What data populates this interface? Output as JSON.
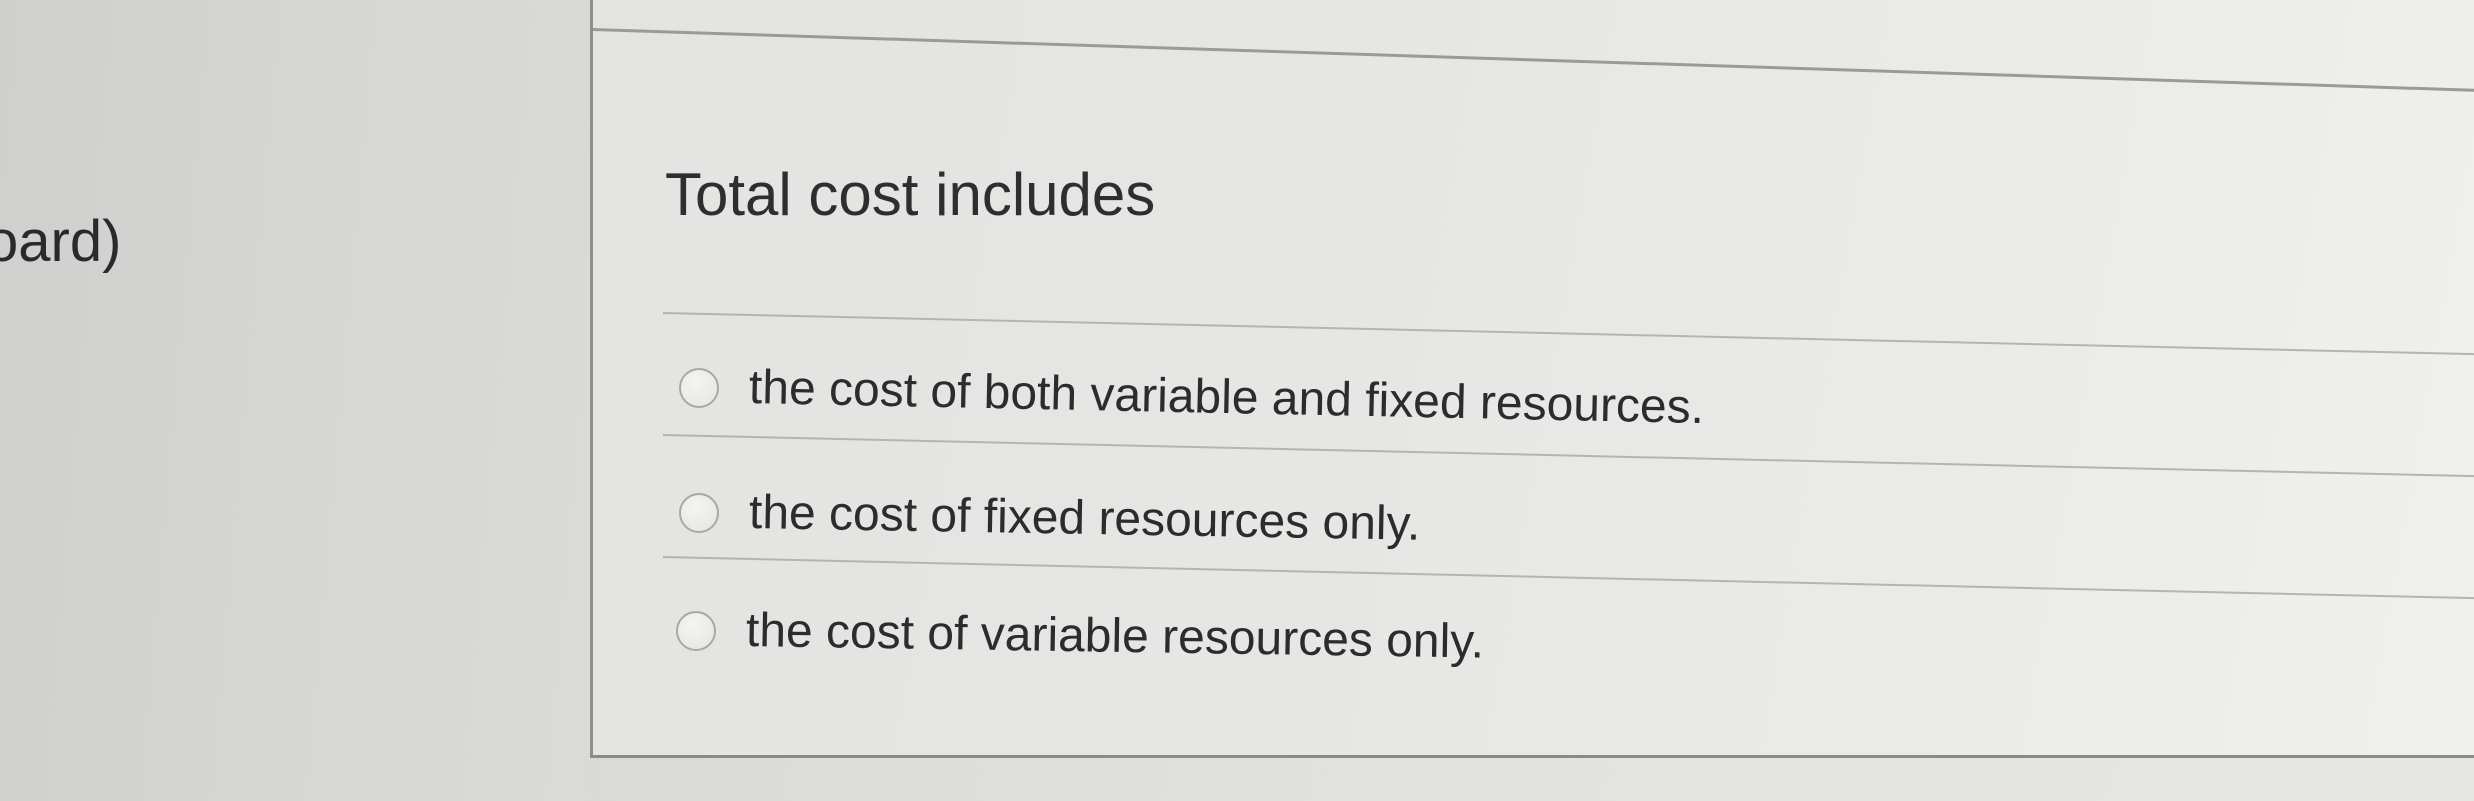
{
  "sidebar": {
    "partial_label": "oard)"
  },
  "question": {
    "prompt": "Total cost includes",
    "options": [
      {
        "label": "the cost of both variable and fixed resources.",
        "selected": false
      },
      {
        "label": "the cost of fixed resources only.",
        "selected": false
      },
      {
        "label": "the cost of variable resources only.",
        "selected": false
      }
    ]
  }
}
